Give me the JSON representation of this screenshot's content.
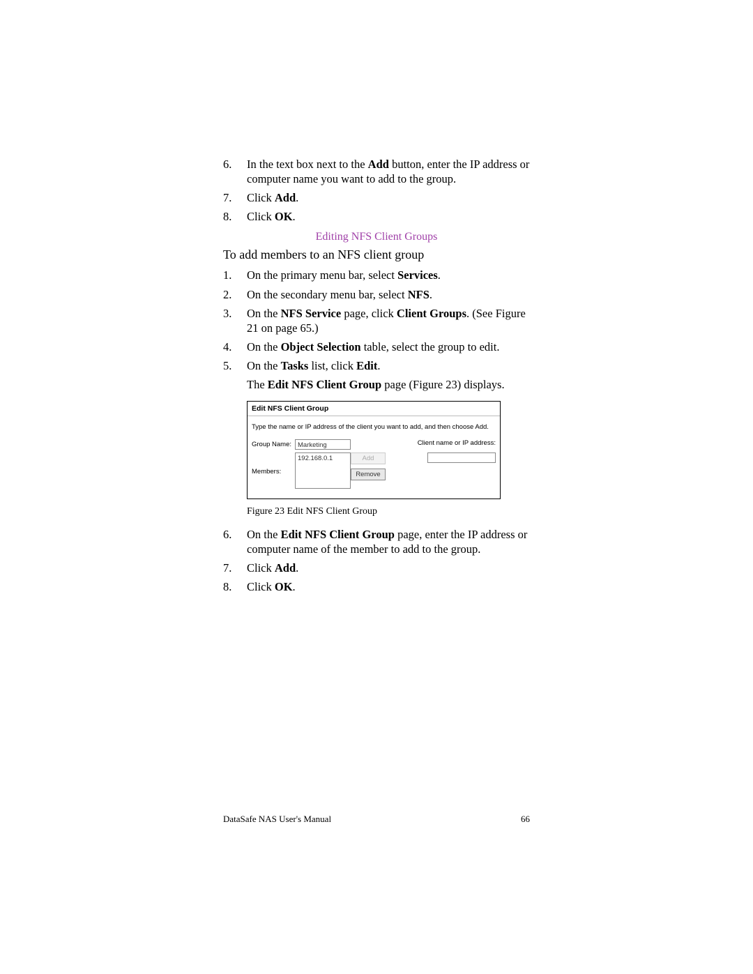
{
  "steps_top": [
    {
      "num": "6.",
      "html": "In the text box next to the <b>Add</b> button, enter the IP address or computer name you want to add to the group."
    },
    {
      "num": "7.",
      "html": "Click <b>Add</b>."
    },
    {
      "num": "8.",
      "html": "Click <b>OK</b>."
    }
  ],
  "section_link": "Editing NFS Client Groups",
  "subhead": "To add members to an NFS client group",
  "steps_mid": [
    {
      "num": "1.",
      "html": "On the primary menu bar, select <b>Services</b>."
    },
    {
      "num": "2.",
      "html": "On the secondary menu bar, select <b>NFS</b>."
    },
    {
      "num": "3.",
      "html": "On the <b>NFS Service</b> page, click <b>Client Groups</b>. (See Figure 21 on page 65.)"
    },
    {
      "num": "4.",
      "html": "On the <b>Object Selection</b> table, select the group to edit."
    },
    {
      "num": "5.",
      "html": "On the <b>Tasks</b> list, click <b>Edit</b>."
    }
  ],
  "result_line": "The <b>Edit NFS Client Group</b> page (Figure 23) displays.",
  "dialog": {
    "title": "Edit NFS Client Group",
    "instruction": "Type the name or IP address of the client you want to add, and then choose Add.",
    "group_name_label": "Group Name:",
    "group_name_value": "Marketing",
    "members_label": "Members:",
    "members_value": "192.168.0.1",
    "client_label": "Client name or IP address:",
    "client_value": "",
    "add_button": "Add",
    "remove_button": "Remove"
  },
  "figure_caption": "Figure 23   Edit NFS Client Group",
  "steps_bottom": [
    {
      "num": "6.",
      "html": "On the <b>Edit NFS Client Group</b> page, enter the IP address or computer name of the member to add to the group."
    },
    {
      "num": "7.",
      "html": "Click <b>Add</b>."
    },
    {
      "num": "8.",
      "html": "Click <b>OK</b>."
    }
  ],
  "footer_left": "DataSafe NAS User's Manual",
  "footer_right": "66"
}
